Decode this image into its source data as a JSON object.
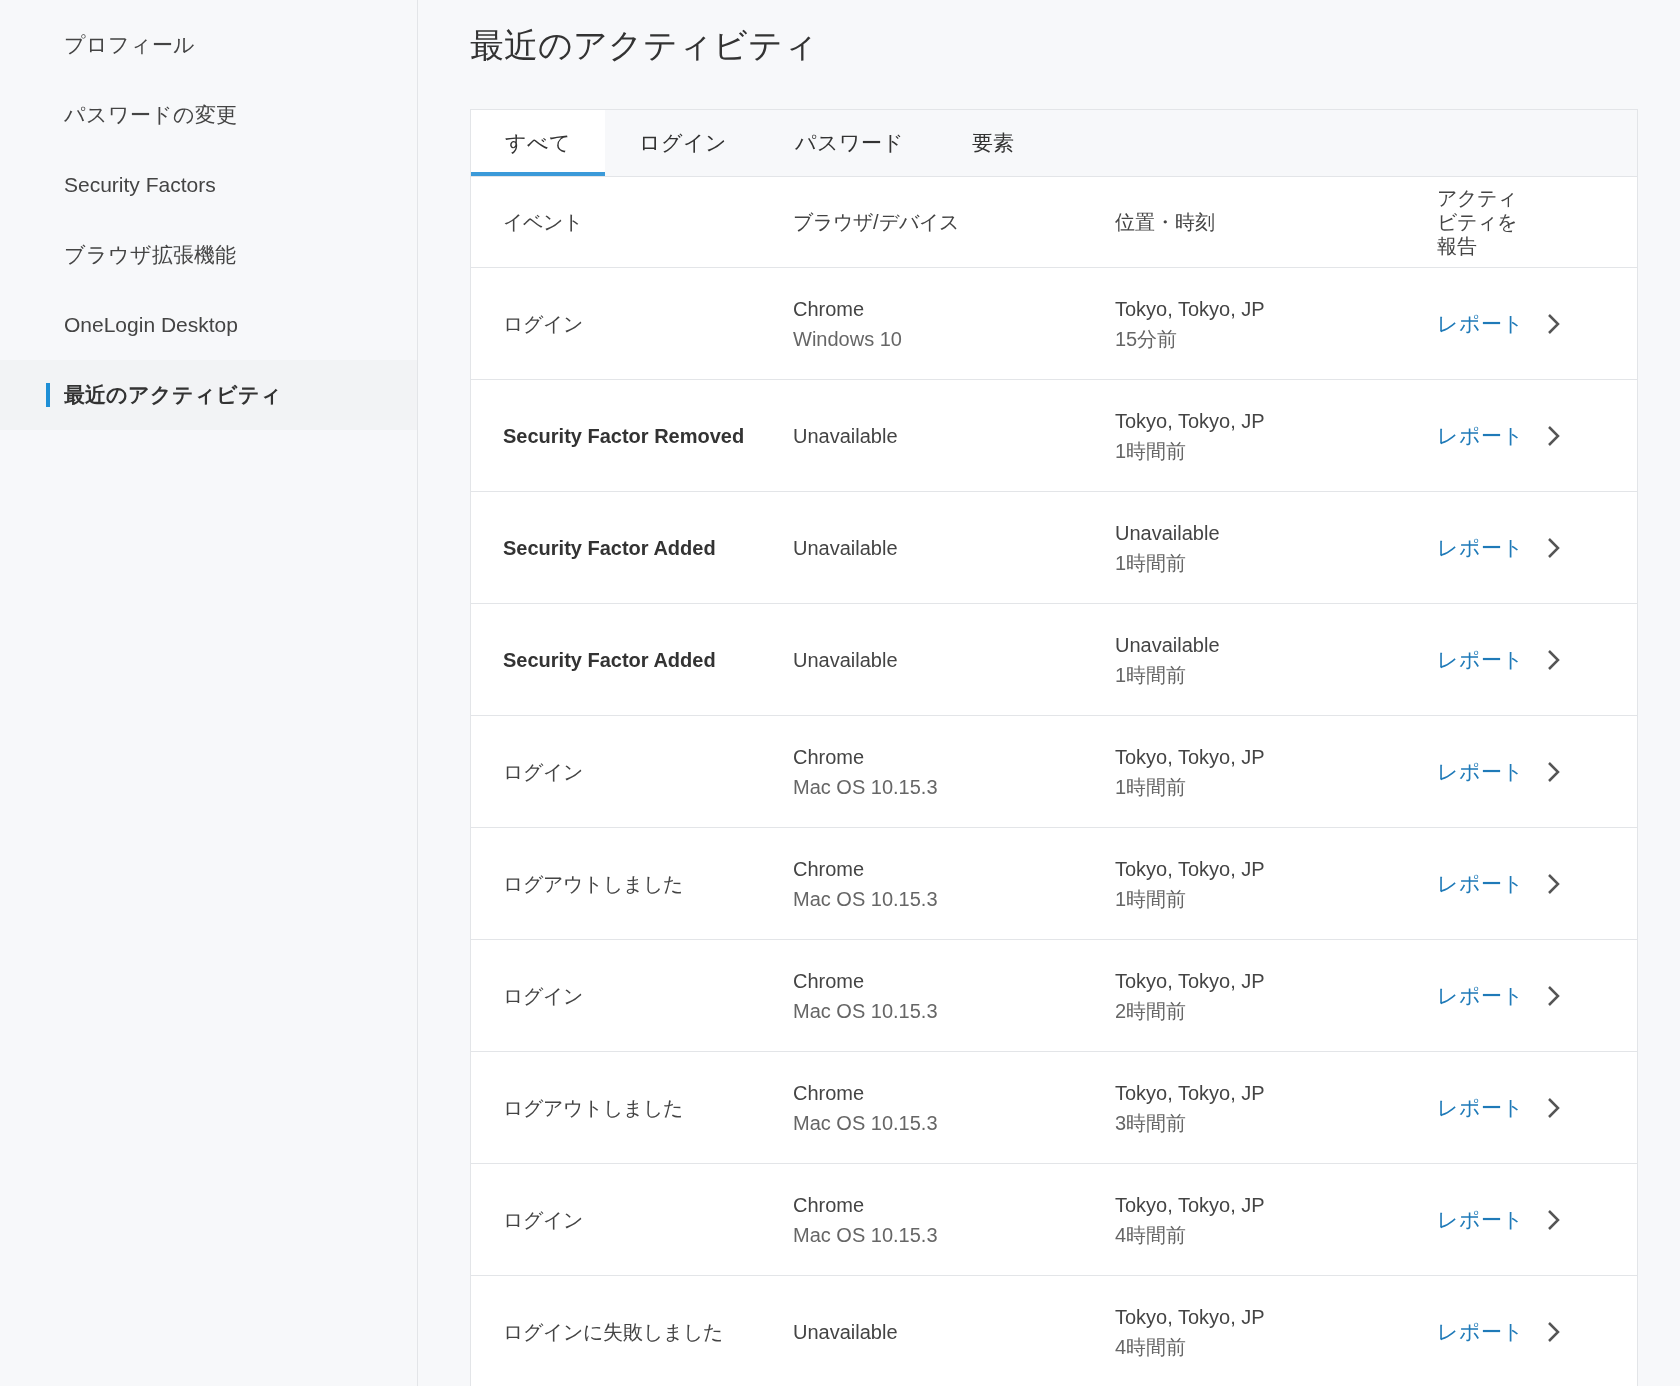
{
  "sidebar": {
    "items": [
      {
        "label": "プロフィール",
        "selected": false
      },
      {
        "label": "パスワードの変更",
        "selected": false
      },
      {
        "label": "Security Factors",
        "selected": false
      },
      {
        "label": "ブラウザ拡張機能",
        "selected": false
      },
      {
        "label": "OneLogin Desktop",
        "selected": false
      },
      {
        "label": "最近のアクティビティ",
        "selected": true
      }
    ]
  },
  "page_title": "最近のアクティビティ",
  "tabs": [
    {
      "label": "すべて",
      "selected": true
    },
    {
      "label": "ログイン",
      "selected": false
    },
    {
      "label": "パスワード",
      "selected": false
    },
    {
      "label": "要素",
      "selected": false
    }
  ],
  "table": {
    "columns": [
      "イベント",
      "ブラウザ/デバイス",
      "位置・時刻",
      "アクティビティを報告"
    ],
    "rows": [
      {
        "event": "ログイン",
        "kind": "plain",
        "browser": "Chrome",
        "device": "Windows 10",
        "location": "Tokyo, Tokyo, JP",
        "time": "15分前",
        "report": "レポート"
      },
      {
        "event": "Security Factor Removed",
        "kind": "strong",
        "browser": "Unavailable",
        "location": "Tokyo, Tokyo, JP",
        "time": "1時間前",
        "report": "レポート"
      },
      {
        "event": "Security Factor Added",
        "kind": "strong",
        "browser": "Unavailable",
        "location": "Unavailable",
        "time": "1時間前",
        "report": "レポート"
      },
      {
        "event": "Security Factor Added",
        "kind": "strong",
        "browser": "Unavailable",
        "location": "Unavailable",
        "time": "1時間前",
        "report": "レポート"
      },
      {
        "event": "ログイン",
        "kind": "plain",
        "browser": "Chrome",
        "device": "Mac OS 10.15.3",
        "location": "Tokyo, Tokyo, JP",
        "time": "1時間前",
        "report": "レポート"
      },
      {
        "event": "ログアウトしました",
        "kind": "plain",
        "browser": "Chrome",
        "device": "Mac OS 10.15.3",
        "location": "Tokyo, Tokyo, JP",
        "time": "1時間前",
        "report": "レポート"
      },
      {
        "event": "ログイン",
        "kind": "plain",
        "browser": "Chrome",
        "device": "Mac OS 10.15.3",
        "location": "Tokyo, Tokyo, JP",
        "time": "2時間前",
        "report": "レポート"
      },
      {
        "event": "ログアウトしました",
        "kind": "plain",
        "browser": "Chrome",
        "device": "Mac OS 10.15.3",
        "location": "Tokyo, Tokyo, JP",
        "time": "3時間前",
        "report": "レポート"
      },
      {
        "event": "ログイン",
        "kind": "plain",
        "browser": "Chrome",
        "device": "Mac OS 10.15.3",
        "location": "Tokyo, Tokyo, JP",
        "time": "4時間前",
        "report": "レポート"
      },
      {
        "event": "ログインに失敗しました",
        "kind": "plain",
        "browser": "Unavailable",
        "location": "Tokyo, Tokyo, JP",
        "time": "4時間前",
        "report": "レポート"
      }
    ]
  }
}
